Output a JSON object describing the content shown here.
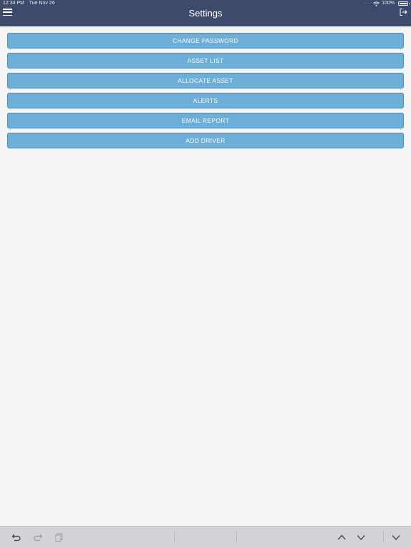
{
  "status_bar": {
    "time": "12:34 PM",
    "date": "Tue Nov 26",
    "battery": "100%"
  },
  "header": {
    "title": "Settings"
  },
  "settings": {
    "buttons": [
      {
        "label": "CHANGE PASSWORD"
      },
      {
        "label": "ASSET LIST"
      },
      {
        "label": "ALLOCATE ASSET"
      },
      {
        "label": "ALERTS"
      },
      {
        "label": "EMAIL REPORT"
      },
      {
        "label": "ADD DRIVER"
      }
    ]
  },
  "icons": {
    "menu": "hamburger-menu-icon",
    "logout": "logout-icon",
    "undo": "undo-icon",
    "redo": "redo-icon",
    "clipboard": "clipboard-icon",
    "prev": "chevron-up-icon",
    "next": "chevron-down-icon",
    "dismiss": "keyboard-dismiss-icon"
  },
  "colors": {
    "header_bg": "#3d4a6b",
    "button_bg": "#6daed6",
    "page_bg": "#f4f4f5",
    "toolbar_bg": "#d1d3d9"
  }
}
